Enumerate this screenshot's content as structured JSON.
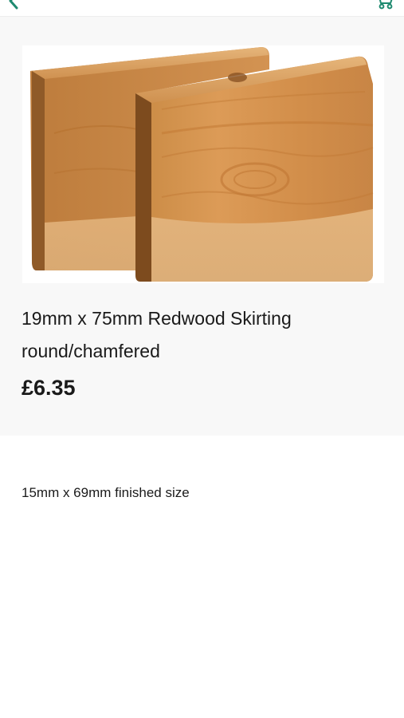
{
  "header": {
    "back_icon": "chevron-left-icon",
    "cart_icon": "shopping-cart-icon",
    "accent_color": "#1f8a70"
  },
  "product": {
    "image_alt": "redwood skirting boards",
    "title": "19mm x 75mm Redwood Skirting round/chamfered",
    "price": "£6.35",
    "description": "15mm x 69mm finished size"
  }
}
